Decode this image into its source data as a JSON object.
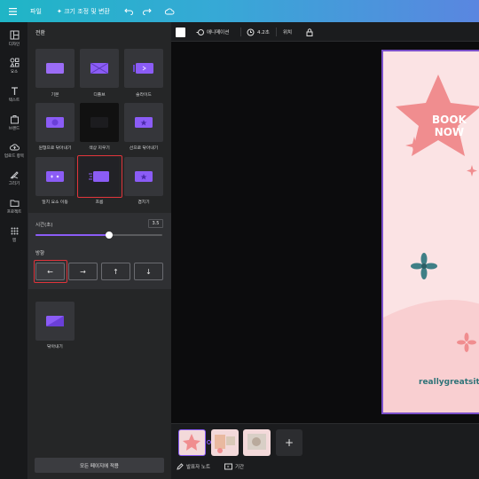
{
  "topbar": {
    "home": "파일",
    "resize": "✦ 크기 조정 및 변환",
    "undo_icon": "undo-icon",
    "redo_icon": "redo-icon",
    "cloud_icon": "cloud-icon"
  },
  "rail": {
    "items": [
      {
        "label": "디자인",
        "icon": "layout-icon"
      },
      {
        "label": "요소",
        "icon": "shapes-icon"
      },
      {
        "label": "텍스트",
        "icon": "text-icon"
      },
      {
        "label": "브랜드",
        "icon": "brand-icon"
      },
      {
        "label": "업로드 항목",
        "icon": "upload-icon"
      },
      {
        "label": "그리기",
        "icon": "draw-icon"
      },
      {
        "label": "프로젝트",
        "icon": "folder-icon"
      },
      {
        "label": "앱",
        "icon": "apps-icon"
      }
    ]
  },
  "panel": {
    "title": "전환",
    "transitions": [
      {
        "label": "기본"
      },
      {
        "label": "디졸브"
      },
      {
        "label": "슬라이드"
      },
      {
        "label": "원형으로 닦아내기"
      },
      {
        "label": "색상 지우기"
      },
      {
        "label": "선으로 닦아내기"
      },
      {
        "label": "일치 요소 이동"
      },
      {
        "label": "흐름"
      },
      {
        "label": "겹치기"
      }
    ],
    "selected_index": 7,
    "duration_label": "시간(초)",
    "duration_value": "3.5",
    "duration_fraction": 0.58,
    "direction_label": "방향",
    "directions": [
      "←",
      "→",
      "↑",
      "↓"
    ],
    "direction_selected": 0,
    "wipe": {
      "label": "닦아내기"
    },
    "apply_button": "모든 페이지에 적용"
  },
  "editbar": {
    "animation": "애니메이션",
    "duration": "4.2초",
    "position": "위치"
  },
  "page": {
    "headline_line1": "BOOK",
    "headline_line2": "NOW",
    "website": "reallygreatsite"
  },
  "bottombar": {
    "add_page": "+",
    "notes": "발표자 노트",
    "duration": "기간"
  },
  "colors": {
    "accent": "#8b5cf6",
    "highlight": "#e0343b",
    "star": "#f08d8f",
    "teal_flower": "#3f7f86",
    "site_text": "#2f7378"
  }
}
